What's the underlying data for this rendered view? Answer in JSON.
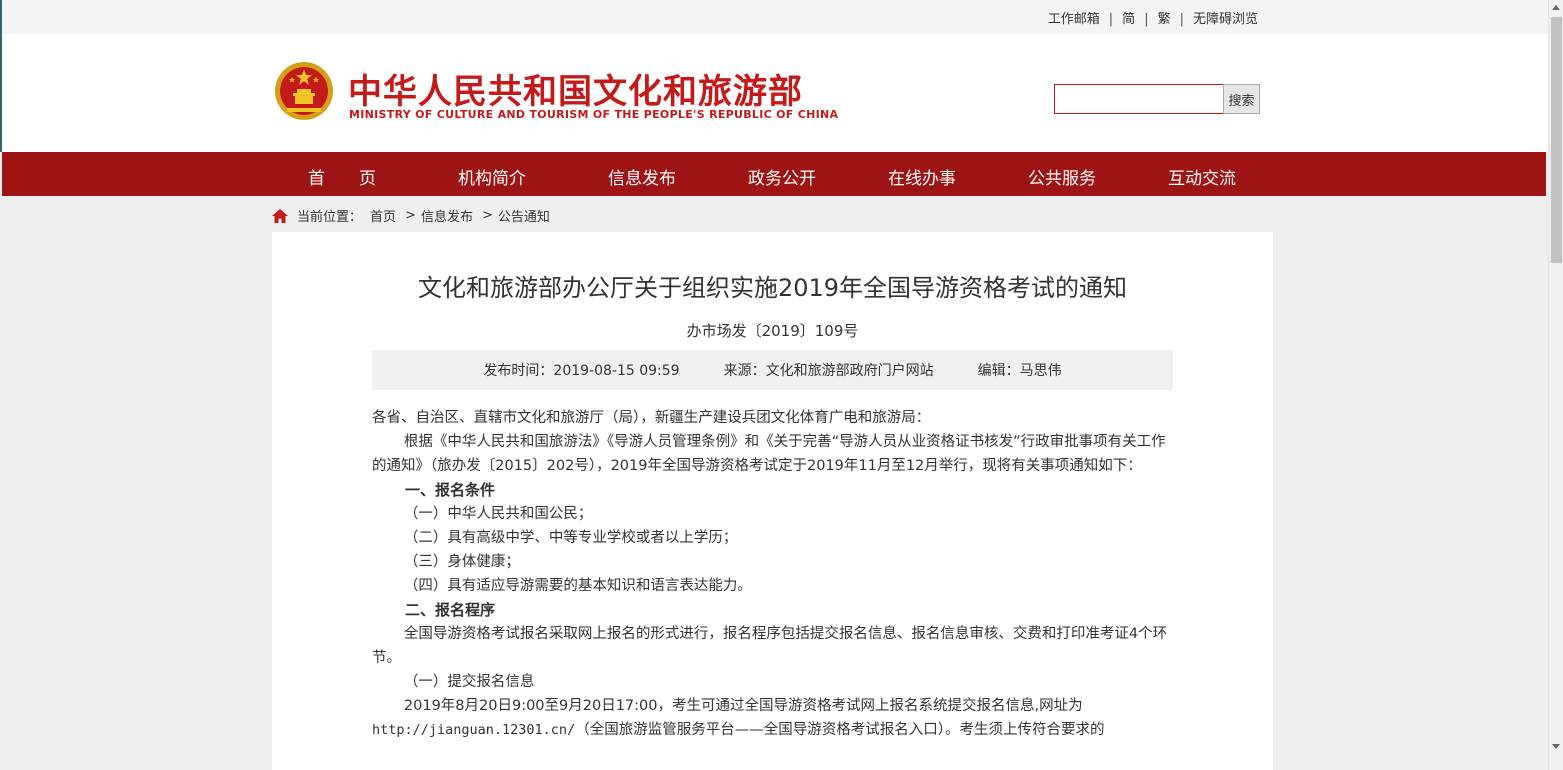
{
  "topbar": {
    "links": [
      "工作邮箱",
      "简",
      "繁",
      "无障碍浏览"
    ]
  },
  "header": {
    "title": "中华人民共和国文化和旅游部",
    "subtitle": "MINISTRY OF CULTURE AND TOURISM OF THE PEOPLE'S REPUBLIC OF CHINA",
    "emblem_icon": "national-emblem-icon",
    "search": {
      "placeholder": "",
      "button_label": "搜索"
    }
  },
  "nav": {
    "items": [
      "首　　页",
      "机构简介",
      "信息发布",
      "政务公开",
      "在线办事",
      "公共服务",
      "互动交流"
    ]
  },
  "breadcrumb": {
    "icon": "home-icon",
    "label": "当前位置：",
    "items": [
      "首页",
      "信息发布",
      "公告通知"
    ],
    "separator": ">"
  },
  "article": {
    "title": "文化和旅游部办公厅关于组织实施2019年全国导游资格考试的通知",
    "doc_number": "办市场发〔2019〕109号",
    "meta": {
      "publish_time": "发布时间：2019-08-15 09:59",
      "source": "来源：文化和旅游部政府门户网站",
      "editor": "编辑：马思伟"
    },
    "paragraphs": {
      "p0": "各省、自治区、直辖市文化和旅游厅（局），新疆生产建设兵团文化体育广电和旅游局：",
      "p1": "根据《中华人民共和国旅游法》《导游人员管理条例》和《关于完善“导游人员从业资格证书核发”行政审批事项有关工作的通知》（旅办发〔2015〕202号），2019年全国导游资格考试定于2019年11月至12月举行，现将有关事项通知如下：",
      "h1": "一、报名条件",
      "p2": "（一）中华人民共和国公民；",
      "p3": "（二）具有高级中学、中等专业学校或者以上学历；",
      "p4": "（三）身体健康；",
      "p5": "（四）具有适应导游需要的基本知识和语言表达能力。",
      "h2": "二、报名程序",
      "p6": "全国导游资格考试报名采取网上报名的形式进行，报名程序包括提交报名信息、报名信息审核、交费和打印准考证4个环节。",
      "p7": "（一）提交报名信息",
      "p8a": "2019年8月20日9:00至9月20日17:00，考生可通过全国导游资格考试网上报名系统提交报名信息,网址为",
      "p8b_url": "http://jianguan.12301.cn/",
      "p8b_rest": "（全国旅游监管服务平台——全国导游资格考试报名入口）。考生须上传符合要求的"
    }
  },
  "colors": {
    "brand_red": "#c41a1a",
    "nav_bg": "#9e1414",
    "page_bg": "#efefef"
  }
}
